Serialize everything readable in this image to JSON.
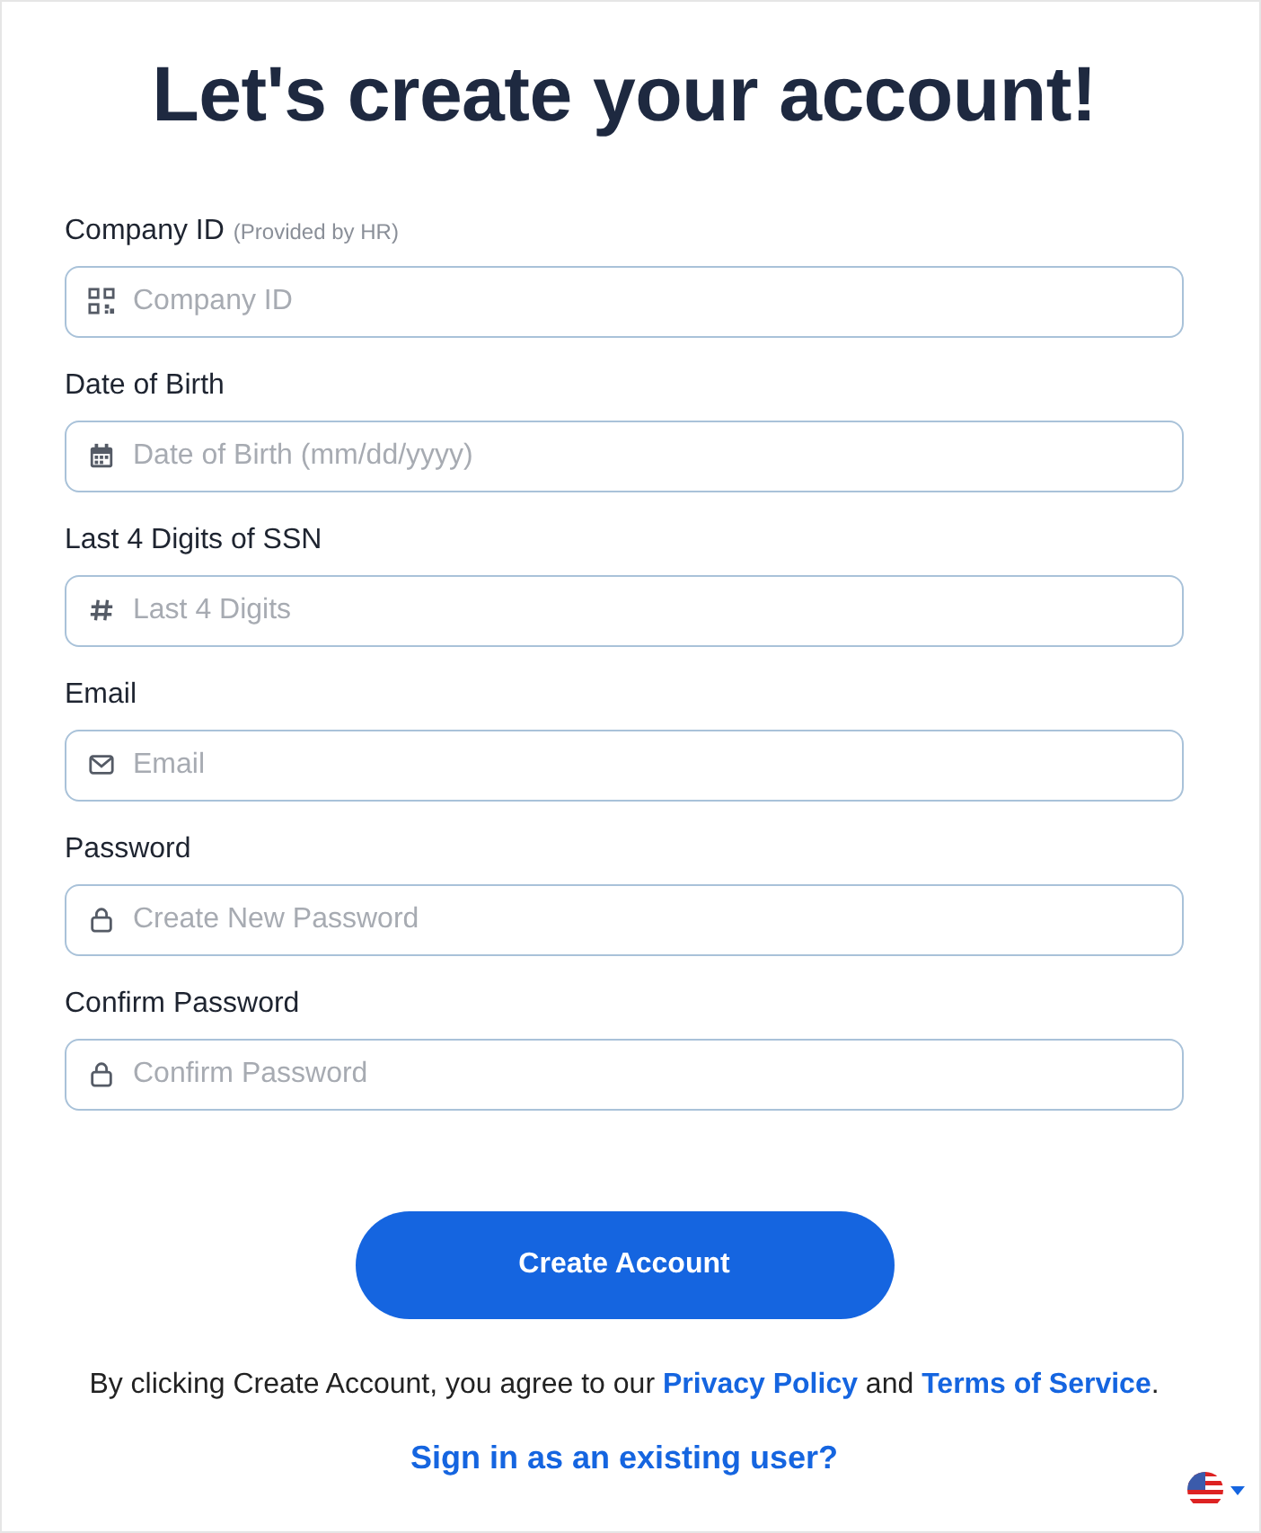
{
  "title": "Let's create your account!",
  "fields": [
    {
      "label": "Company ID",
      "hint": "(Provided by HR)",
      "kind": "qr",
      "placeholder": "Company ID"
    },
    {
      "label": "Date of Birth",
      "kind": "calendar",
      "placeholder": "Date of Birth (mm/dd/yyyy)"
    },
    {
      "label": "Last 4 Digits of SSN",
      "kind": "hash",
      "placeholder": "Last 4 Digits"
    },
    {
      "label": "Email",
      "kind": "mail",
      "placeholder": "Email"
    },
    {
      "label": "Password",
      "kind": "lock",
      "placeholder": "Create New Password"
    },
    {
      "label": "Confirm Password",
      "kind": "lock",
      "placeholder": "Confirm Password"
    }
  ],
  "submit": "Create Account",
  "legal": [
    {
      "kind": "text",
      "text": "By clicking Create Account, you agree to our "
    },
    {
      "kind": "link",
      "text": "Privacy Policy"
    },
    {
      "kind": "text",
      "text": " and "
    },
    {
      "kind": "link",
      "text": "Terms of Service"
    },
    {
      "kind": "text",
      "text": "."
    }
  ],
  "signin": "Sign in as an existing user?"
}
